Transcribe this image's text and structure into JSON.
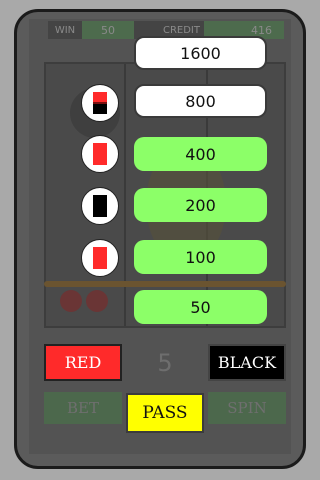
{
  "stats": {
    "win_label": "WIN",
    "win_value": "50",
    "credit_label": "CREDIT",
    "credit_value": "416"
  },
  "ladder": {
    "amounts": [
      "1600",
      "800",
      "400",
      "200",
      "100",
      "50"
    ],
    "history": [
      {
        "card": "red-black-card-icon"
      },
      {
        "card": "red-card-icon"
      },
      {
        "card": "black-card-icon"
      },
      {
        "card": "red-card-icon"
      }
    ]
  },
  "controls": {
    "red_label": "RED",
    "black_label": "BLACK",
    "gamble_count": "5",
    "bet_label": "BET",
    "pass_label": "PASS",
    "spin_label": "SPIN"
  },
  "colors": {
    "red": "#ff2a2a",
    "black": "#000000",
    "amount_active": "#8cff68",
    "pass": "#ffff00"
  }
}
